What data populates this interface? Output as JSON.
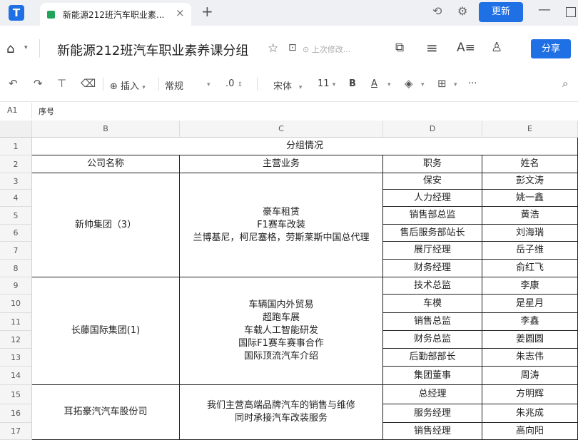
{
  "tab": {
    "title": "新能源212班汽车职业素...",
    "close": "×",
    "new": "+"
  },
  "window": {
    "update_label": "更新",
    "minimize": "—"
  },
  "header": {
    "doc_title": "新能源212班汽车职业素养课分组",
    "save_status": "上次修改...",
    "share_label": "分享"
  },
  "toolbar": {
    "insert": "插入",
    "format": "常规",
    "decimal": ".0",
    "font": "宋体",
    "size": "11",
    "bold": "B",
    "text_color": "A",
    "more": "···"
  },
  "formula": {
    "cell_ref": "A1",
    "content": "序号"
  },
  "columns": [
    "B",
    "C",
    "D",
    "E"
  ],
  "rows": [
    "1",
    "2",
    "3",
    "4",
    "5",
    "6",
    "7",
    "8",
    "9",
    "10",
    "11",
    "12",
    "13",
    "14",
    "15",
    "16",
    "17"
  ],
  "sheet": {
    "title": "分组情况",
    "headers": [
      "公司名称",
      "主营业务",
      "职务",
      "姓名"
    ],
    "groups": [
      {
        "company": "新帅集团（3）",
        "business": "豪车租赁\nF1赛车改装\n兰博基尼，柯尼塞格，劳斯莱斯中国总代理",
        "members": [
          [
            "保安",
            "彭文涛"
          ],
          [
            "人力经理",
            "姚一鑫"
          ],
          [
            "销售部总监",
            "黄浩"
          ],
          [
            "售后服务部站长",
            "刘海瑞"
          ],
          [
            "展厅经理",
            "岳子维"
          ],
          [
            "财务经理",
            "俞红飞"
          ]
        ]
      },
      {
        "company": "长藤国际集团(1)",
        "business": "车辆国内外贸易\n超跑车展\n车载人工智能研发\n国际F1赛车赛事合作\n国际顶流汽车介绍",
        "members": [
          [
            "技术总监",
            "李康"
          ],
          [
            "车模",
            "是星月"
          ],
          [
            "销售总监",
            "李鑫"
          ],
          [
            "财务总监",
            "姜圆圆"
          ],
          [
            "后勤部部长",
            "朱志伟"
          ],
          [
            "集团董事",
            "周涛"
          ]
        ]
      },
      {
        "company": "耳拓豪汽汽车股份司",
        "business": "我们主营高端品牌汽车的销售与维修\n同时承接汽车改装服务",
        "members": [
          [
            "总经理",
            "方明辉"
          ],
          [
            "服务经理",
            "朱兆成"
          ],
          [
            "销售经理",
            "高向阳"
          ]
        ]
      }
    ]
  }
}
